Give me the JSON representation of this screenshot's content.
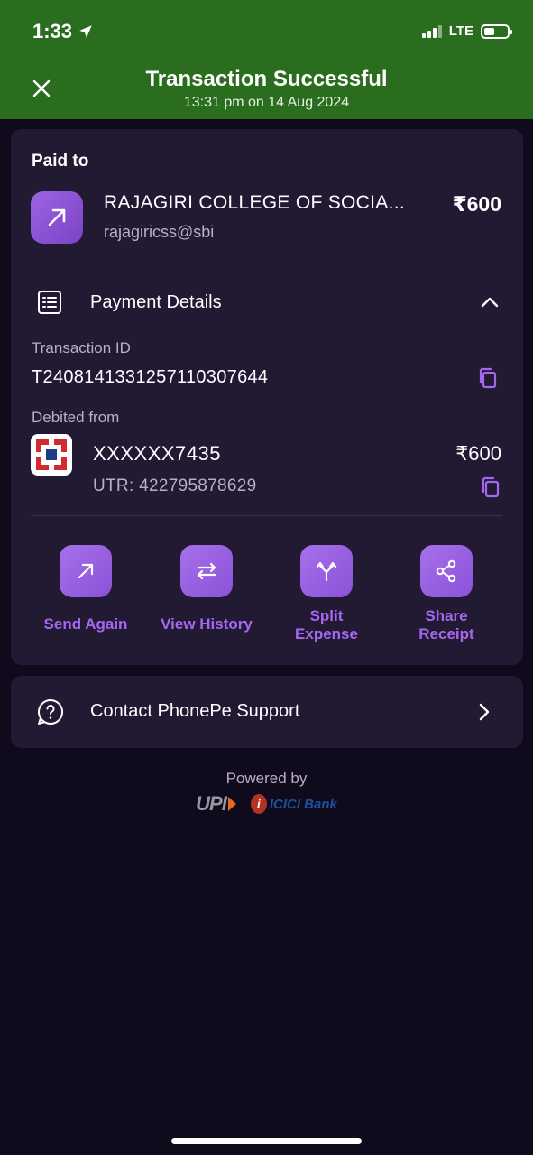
{
  "status_bar": {
    "time": "1:33",
    "network": "LTE"
  },
  "header": {
    "title": "Transaction Successful",
    "subtitle": "13:31 pm on 14 Aug 2024"
  },
  "paid_to": {
    "label": "Paid to",
    "name": "RAJAGIRI COLLEGE OF SOCIA...",
    "upi_id": "rajagiricss@sbi",
    "amount": "₹600"
  },
  "payment_details": {
    "title": "Payment Details",
    "transaction_id_label": "Transaction ID",
    "transaction_id": "T2408141331257110307644",
    "debited_from_label": "Debited from",
    "account": "XXXXXX7435",
    "amount": "₹600",
    "utr": "UTR: 422795878629"
  },
  "actions": [
    {
      "label": "Send Again",
      "icon": "arrow-up-right-icon"
    },
    {
      "label": "View History",
      "icon": "swap-arrows-icon"
    },
    {
      "label": "Split Expense",
      "icon": "split-icon"
    },
    {
      "label": "Share Receipt",
      "icon": "share-icon"
    }
  ],
  "support": {
    "label": "Contact PhonePe Support"
  },
  "footer": {
    "powered_by": "Powered by",
    "upi": "UPI",
    "bank": "ICICI Bank"
  },
  "colors": {
    "header_green": "#2a6d1f",
    "accent_purple": "#a566f0",
    "card_bg": "#221a33",
    "page_bg": "#0f0a1c"
  }
}
